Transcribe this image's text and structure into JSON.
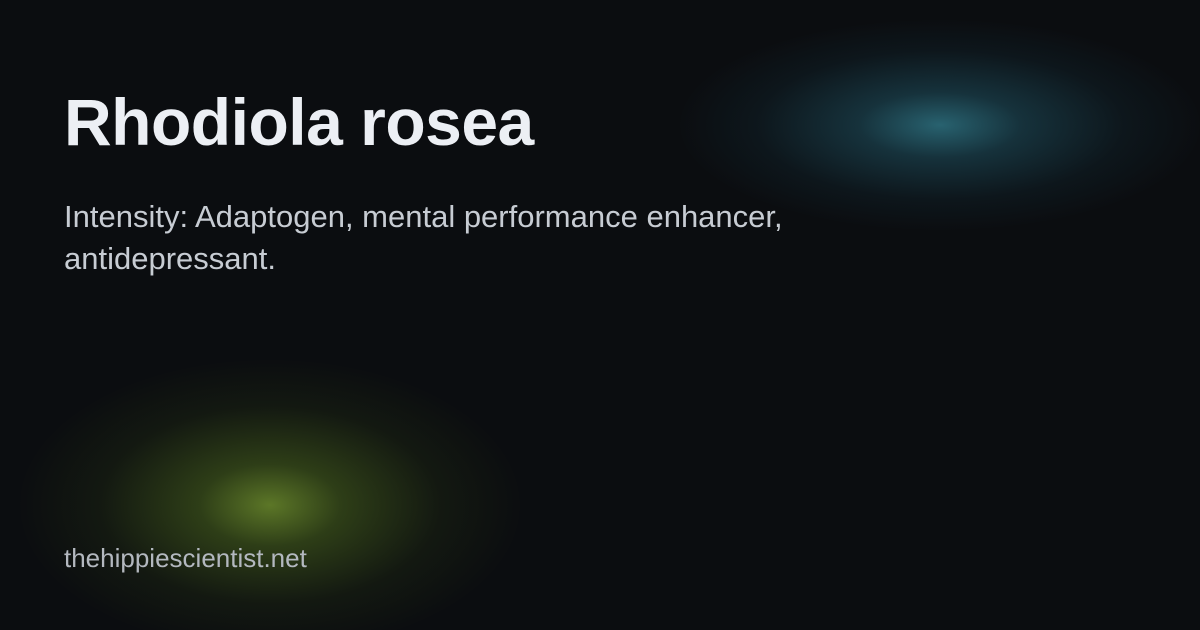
{
  "card": {
    "title": "Rhodiola rosea",
    "description": "Intensity: Adaptogen, mental performance enhancer, antidepressant.",
    "site": "thehippiescientist.net"
  },
  "colors": {
    "background": "#0b0d10",
    "title_text": "#eceff4",
    "description_text": "#c7ccd3",
    "site_text": "#b3b8bf",
    "glow_teal": "#3a96aa",
    "glow_green": "#70912d"
  }
}
